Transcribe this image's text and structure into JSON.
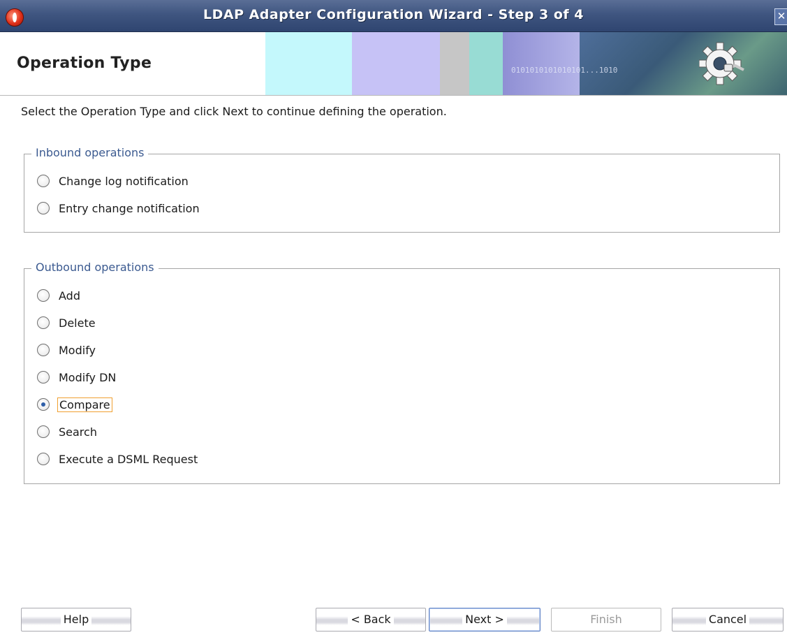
{
  "window": {
    "title": "LDAP Adapter Configuration Wizard - Step 3 of 4",
    "close_glyph": "✕",
    "title_bar_color": "#3f5580"
  },
  "header": {
    "title": "Operation Type",
    "banner_text": "0101010101010101...1010"
  },
  "instruction": "Select the Operation Type and click Next to continue defining the operation.",
  "inbound": {
    "legend": "Inbound operations",
    "options": [
      {
        "label": "Change log notification",
        "checked": false
      },
      {
        "label": "Entry change notification",
        "checked": false
      }
    ]
  },
  "outbound": {
    "legend": "Outbound operations",
    "options": [
      {
        "label": "Add",
        "checked": false
      },
      {
        "label": "Delete",
        "checked": false
      },
      {
        "label": "Modify",
        "checked": false
      },
      {
        "label": "Modify DN",
        "checked": false
      },
      {
        "label": "Compare",
        "checked": true
      },
      {
        "label": "Search",
        "checked": false
      },
      {
        "label": "Execute a DSML Request",
        "checked": false
      }
    ],
    "selected": "Compare"
  },
  "buttons": {
    "help": "Help",
    "back": "< Back",
    "next": "Next >",
    "finish": "Finish",
    "cancel": "Cancel"
  },
  "colors": {
    "accent": "#3b5a90",
    "focus": "#f0a030"
  },
  "icons": [
    "app-icon",
    "close-icon",
    "gear-plug-icon"
  ]
}
